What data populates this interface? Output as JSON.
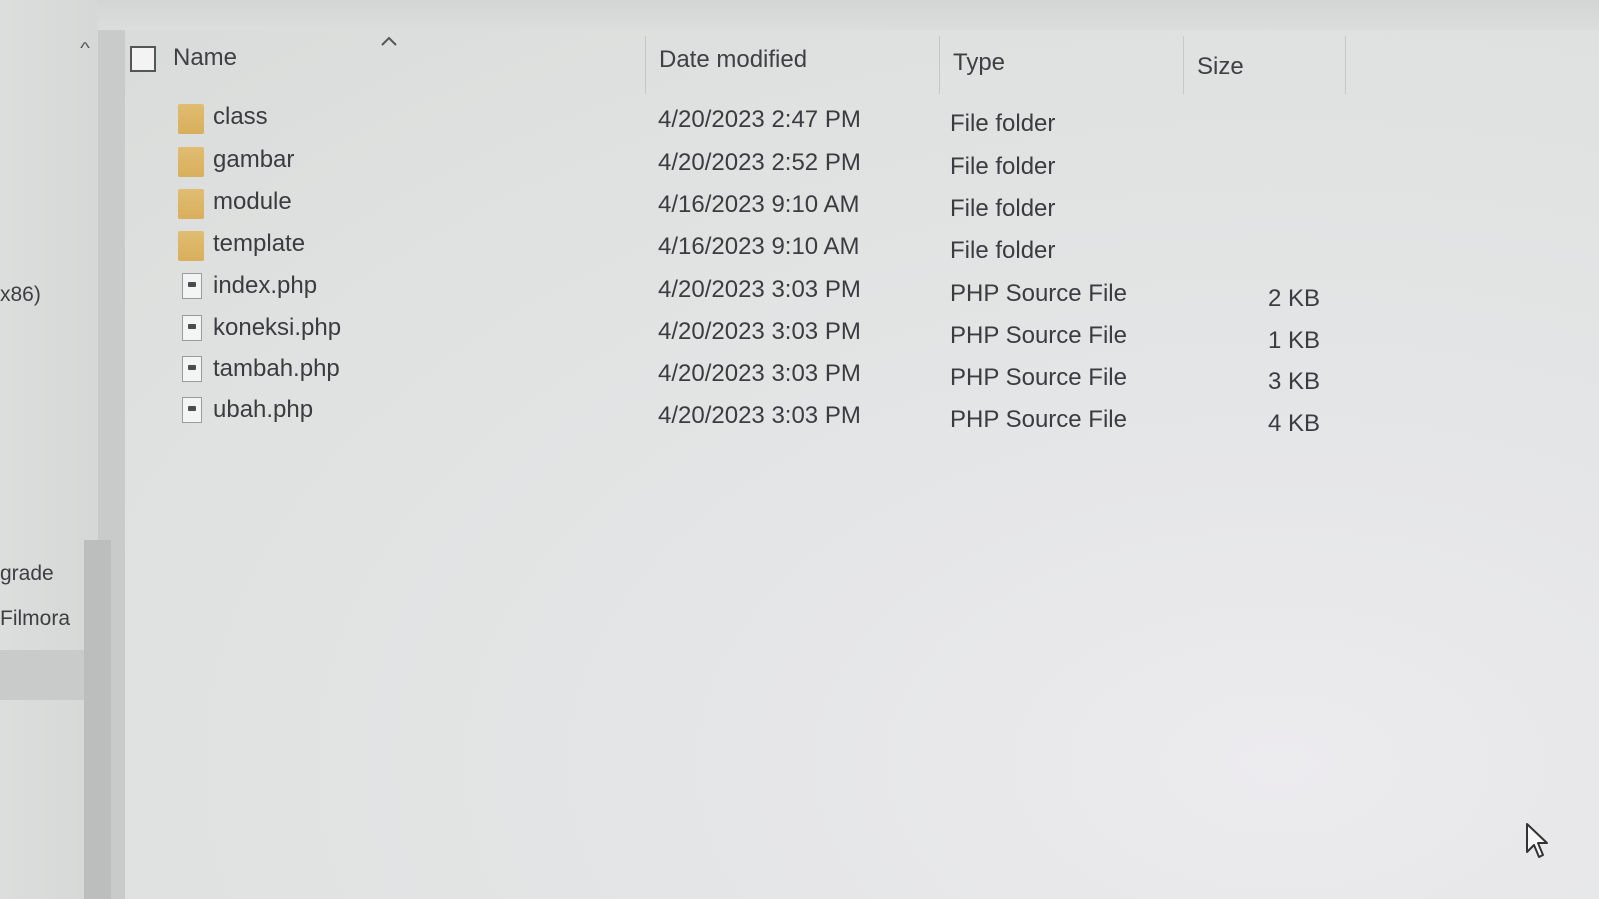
{
  "nav_pane": {
    "items": [
      "x86)",
      "grade",
      "Filmora"
    ]
  },
  "columns": {
    "name": "Name",
    "date_modified": "Date modified",
    "type": "Type",
    "size": "Size"
  },
  "files": [
    {
      "name": "class",
      "date": "4/20/2023 2:47 PM",
      "type": "File folder",
      "size": "",
      "icon": "folder-icon"
    },
    {
      "name": "gambar",
      "date": "4/20/2023 2:52 PM",
      "type": "File folder",
      "size": "",
      "icon": "folder-icon"
    },
    {
      "name": "module",
      "date": "4/16/2023 9:10 AM",
      "type": "File folder",
      "size": "",
      "icon": "folder-icon"
    },
    {
      "name": "template",
      "date": "4/16/2023 9:10 AM",
      "type": "File folder",
      "size": "",
      "icon": "folder-icon"
    },
    {
      "name": "index.php",
      "date": "4/20/2023 3:03 PM",
      "type": "PHP Source File",
      "size": "2 KB",
      "icon": "php-file-icon"
    },
    {
      "name": "koneksi.php",
      "date": "4/20/2023 3:03 PM",
      "type": "PHP Source File",
      "size": "1 KB",
      "icon": "php-file-icon"
    },
    {
      "name": "tambah.php",
      "date": "4/20/2023 3:03 PM",
      "type": "PHP Source File",
      "size": "3 KB",
      "icon": "php-file-icon"
    },
    {
      "name": "ubah.php",
      "date": "4/20/2023 3:03 PM",
      "type": "PHP Source File",
      "size": "4 KB",
      "icon": "php-file-icon"
    }
  ],
  "colors": {
    "folder": "#d9b062",
    "background": "#e0e2e1",
    "text": "#3a3d40"
  }
}
